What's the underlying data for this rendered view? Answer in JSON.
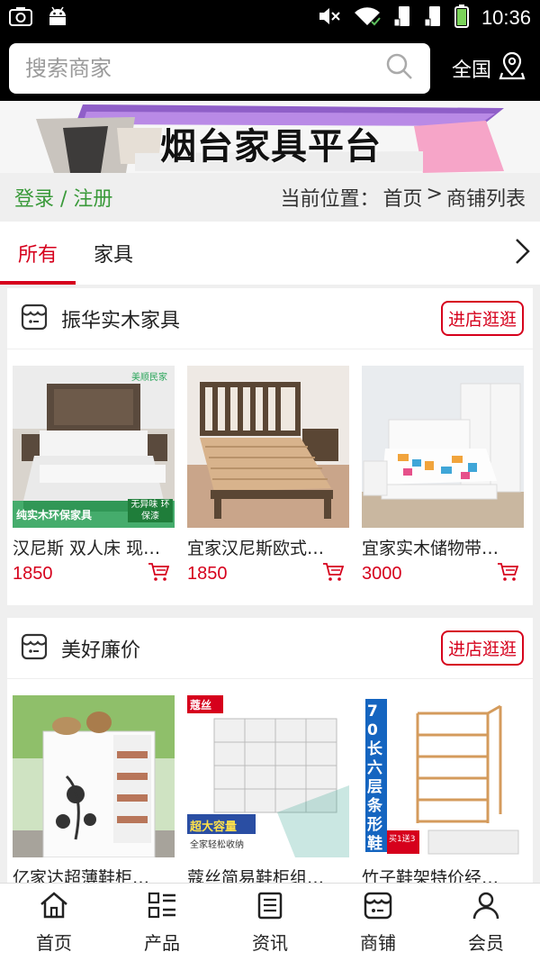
{
  "status_bar": {
    "time": "10:36",
    "left_icons": [
      "screenshot-icon",
      "android-icon"
    ],
    "right_icons": [
      "mute-icon",
      "wifi-icon",
      "sim1-icon",
      "sim2-icon",
      "battery-icon"
    ]
  },
  "header": {
    "search_placeholder": "搜索商家",
    "region_label": "全国"
  },
  "banner": {
    "title": "烟台家具平台"
  },
  "breadcrumb_bar": {
    "login": "登录 / 注册",
    "location_prefix": "当前位置：",
    "home": "首页",
    "separator": ">",
    "current": "商铺列表"
  },
  "tabs": [
    {
      "label": "所有",
      "active": true
    },
    {
      "label": "家具",
      "active": false
    }
  ],
  "shops": [
    {
      "name": "振华实木家具",
      "visit_label": "进店逛逛",
      "products": [
        {
          "name": "汉尼斯 双人床 现…",
          "price": "1850",
          "image_caption": "纯实木环保家具",
          "image_badge": "无异味 环保漆",
          "image_brand": "美顺民家"
        },
        {
          "name": "宜家汉尼斯欧式…",
          "price": "1850"
        },
        {
          "name": "宜家实木储物带…",
          "price": "3000"
        }
      ]
    },
    {
      "name": "美好廉价",
      "visit_label": "进店逛逛",
      "products": [
        {
          "name": "亿家达超薄鞋柜…",
          "price": ""
        },
        {
          "name": "蔻丝简易鞋柜组…",
          "price": "",
          "image_brand": "蔻丝",
          "image_caption": "超大容量",
          "image_sub": "全家轻松收纳"
        },
        {
          "name": "竹子鞋架特价经…",
          "price": "",
          "image_vertical": "70长六层条形鞋架",
          "image_badge": "买1送3"
        }
      ]
    }
  ],
  "bottom_nav": [
    {
      "label": "首页",
      "icon": "home-icon"
    },
    {
      "label": "产品",
      "icon": "product-list-icon"
    },
    {
      "label": "资讯",
      "icon": "news-icon"
    },
    {
      "label": "商铺",
      "icon": "shop-icon"
    },
    {
      "label": "会员",
      "icon": "member-icon"
    }
  ],
  "colors": {
    "accent": "#d6001c",
    "login_green": "#3a9a3a",
    "header_bg": "#000000"
  }
}
